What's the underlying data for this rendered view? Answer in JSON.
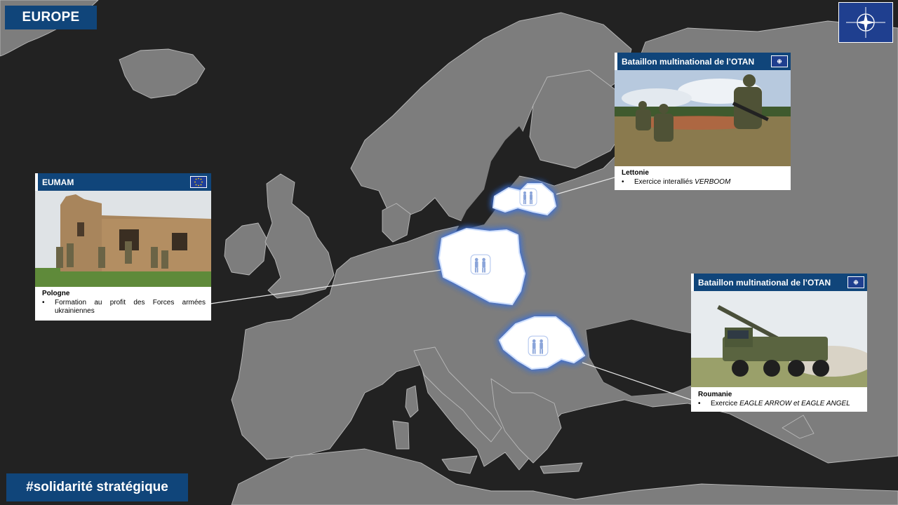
{
  "title": "EUROPE",
  "hashtag": "#solidarité stratégique",
  "colors": {
    "accent": "#10457a",
    "land": "#7d7d7d",
    "sea": "#222222",
    "highlight": "#ffffff",
    "glow": "#3b6fd8"
  },
  "highlighted_countries": [
    "Lettonie",
    "Pologne",
    "Roumanie"
  ],
  "cards": {
    "eumam": {
      "header": "EUMAM",
      "flag_icon": "eu-flag-icon",
      "country": "Pologne",
      "bullet": "Formation au profit des Forces armées ukrainiennes"
    },
    "latvia": {
      "header": "Bataillon multinational de l’OTAN",
      "flag_icon": "nato-flag-icon",
      "country": "Lettonie",
      "bullet_prefix": "Exercice interalliés ",
      "bullet_em": "VERBOOM"
    },
    "romania": {
      "header": "Bataillon multinational de l’OTAN",
      "flag_icon": "nato-flag-icon",
      "country": "Roumanie",
      "bullet_prefix": "Exercice ",
      "bullet_em": "EAGLE ARROW et EAGLE ANGEL"
    }
  }
}
